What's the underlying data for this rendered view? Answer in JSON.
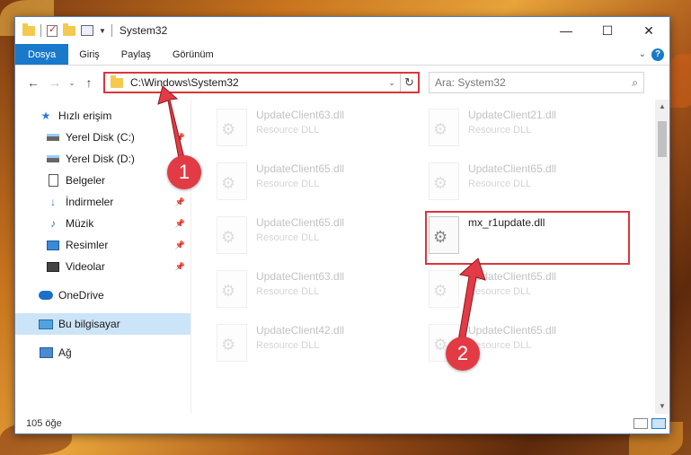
{
  "window": {
    "title": "System32",
    "controls": {
      "minimize": "—",
      "maximize": "☐",
      "close": "✕"
    }
  },
  "ribbon": {
    "tabs": [
      "Dosya",
      "Giriş",
      "Paylaş",
      "Görünüm"
    ],
    "help": "?"
  },
  "nav": {
    "back": "←",
    "forward": "→",
    "recent": "⌄",
    "up": "↑",
    "address": "C:\\Windows\\System32",
    "search_placeholder": "Ara: System32"
  },
  "sidebar": {
    "quick_access": "Hızlı erişim",
    "items": [
      {
        "label": "Yerel Disk (C:)",
        "icon": "drive-icon",
        "pinned": true
      },
      {
        "label": "Yerel Disk (D:)",
        "icon": "drive-icon",
        "pinned": false
      },
      {
        "label": "Belgeler",
        "icon": "document-icon",
        "pinned": false
      },
      {
        "label": "İndirmeler",
        "icon": "download-icon",
        "pinned": true
      },
      {
        "label": "Müzik",
        "icon": "music-icon",
        "pinned": true
      },
      {
        "label": "Resimler",
        "icon": "pictures-icon",
        "pinned": true
      },
      {
        "label": "Videolar",
        "icon": "videos-icon",
        "pinned": true
      }
    ],
    "onedrive": "OneDrive",
    "this_pc": "Bu bilgisayar",
    "network": "Ağ"
  },
  "files": [
    {
      "name": "UpdateClient63.dll",
      "type": "Resource DLL",
      "faded": true
    },
    {
      "name": "UpdateClient21.dll",
      "type": "Resource DLL",
      "faded": true
    },
    {
      "name": "UpdateClient65.dll",
      "type": "Resource DLL",
      "faded": true
    },
    {
      "name": "UpdateClient65.dll",
      "type": "Resource DLL",
      "faded": true
    },
    {
      "name": "UpdateClient65.dll",
      "type": "Resource DLL",
      "faded": true
    },
    {
      "name": "mx_r1update.dll",
      "type": "",
      "faded": false
    },
    {
      "name": "UpdateClient63.dll",
      "type": "Resource DLL",
      "faded": true
    },
    {
      "name": "UpdateClient65.dll",
      "type": "Resource DLL",
      "faded": true
    },
    {
      "name": "UpdateClient42.dll",
      "type": "Resource DLL",
      "faded": true
    },
    {
      "name": "UpdateClient65.dll",
      "type": "Resource DLL",
      "faded": true
    }
  ],
  "status": {
    "count": "105 öğe"
  },
  "annotations": {
    "badge1": "1",
    "badge2": "2",
    "color": "#e33b45"
  }
}
